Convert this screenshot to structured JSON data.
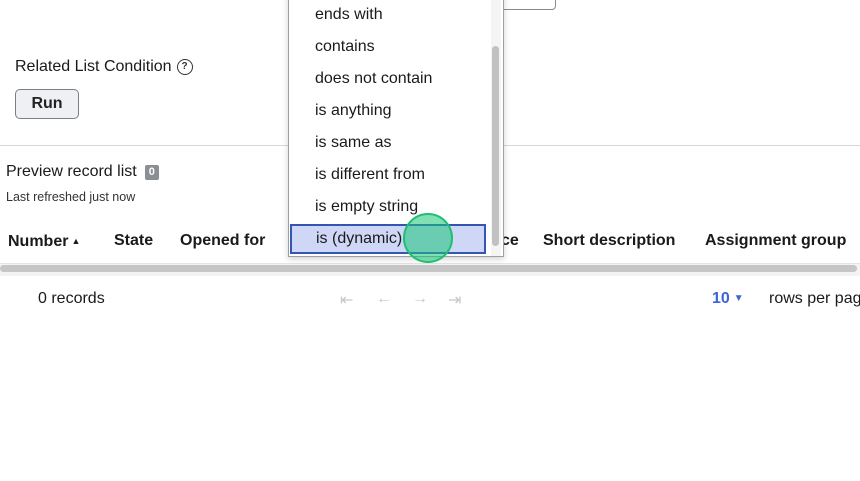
{
  "related_list": {
    "condition_label": "Related List Condition",
    "help_icon_glyph": "?",
    "run_label": "Run"
  },
  "preview": {
    "title": "Preview record list",
    "count": "0",
    "refreshed": "Last refreshed just now"
  },
  "table": {
    "columns": [
      {
        "label": "Number",
        "sorted": "ascending"
      },
      {
        "label": "State"
      },
      {
        "label": "Opened for"
      },
      {
        "label": "ce"
      },
      {
        "label": "Short description"
      },
      {
        "label": "Assignment group"
      }
    ],
    "sort_icon": "▲"
  },
  "footer": {
    "records": "0 records",
    "pager_icons": [
      "first-page-icon",
      "prev-page-icon",
      "next-page-icon",
      "last-page-icon"
    ],
    "pager_glyphs": [
      "⇤",
      "←",
      "→",
      "⇥"
    ],
    "rows_value": "10",
    "rows_caret": "▼",
    "rows_label": "rows per pag"
  },
  "operator_dropdown": {
    "options": [
      "ends with",
      "contains",
      "does not contain",
      "is anything",
      "is same as",
      "is different from",
      "is empty string",
      "is (dynamic)"
    ],
    "selected": "is (dynamic)"
  },
  "colors": {
    "accent": "#3c64d6",
    "selected_bg": "#cfd7f7",
    "selected_border": "#3554b4",
    "cursor": "#1fbf6e"
  }
}
